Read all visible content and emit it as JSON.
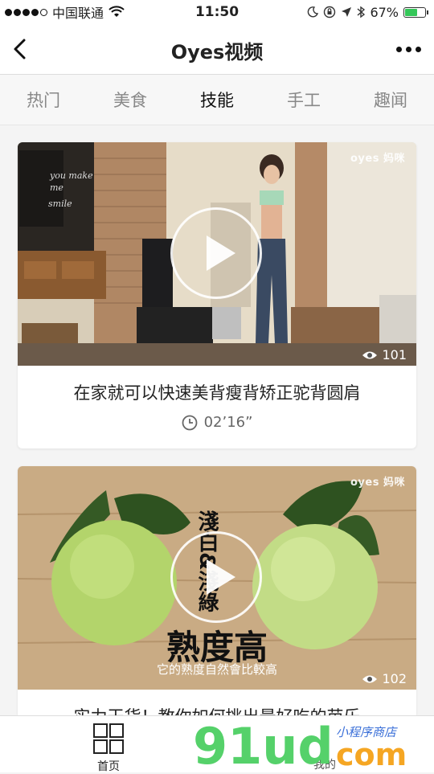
{
  "status_bar": {
    "carrier": "中国联通",
    "time": "11:50",
    "battery": "67%",
    "battery_level": 0.67
  },
  "nav": {
    "title": "Oyes视频"
  },
  "tabs": [
    {
      "label": "热门",
      "active": false
    },
    {
      "label": "美食",
      "active": false
    },
    {
      "label": "技能",
      "active": true
    },
    {
      "label": "手工",
      "active": false
    },
    {
      "label": "趣闻",
      "active": false
    }
  ],
  "videos": [
    {
      "title": "在家就可以快速美背瘦背矫正驼背圆肩",
      "duration": "02’16”",
      "views": "101",
      "watermark": "oyes 妈咪"
    },
    {
      "title": "实力干货！教你如何挑出最好吃的芭乐",
      "views": "102",
      "watermark": "oyes 妈咪",
      "overlay_vertical": "淺白&淺綠",
      "overlay_big": "熟度高",
      "overlay_caption": "它的熟度自然會比較高"
    }
  ],
  "tab_bar": {
    "home_label": "首页",
    "mine_label": "我的"
  },
  "watermark": {
    "brand": "91ud",
    "domain": "com",
    "tagline": "小程序商店"
  }
}
